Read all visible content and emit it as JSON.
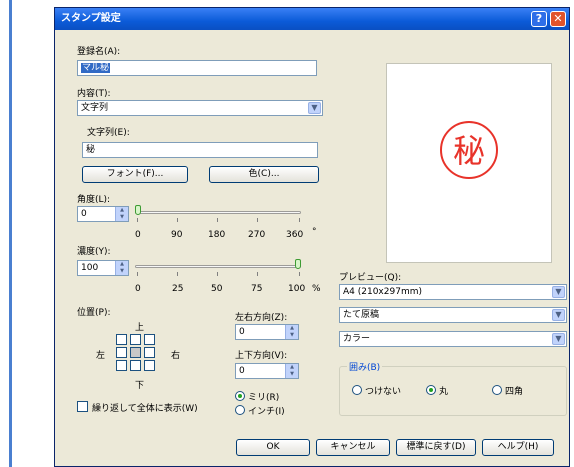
{
  "window": {
    "title": "スタンプ設定",
    "help_glyph": "?",
    "close_glyph": "✕"
  },
  "name": {
    "label": "登録名(A):",
    "value": "マル秘"
  },
  "content": {
    "label": "内容(T):",
    "value": "文字列"
  },
  "text": {
    "label": "文字列(E):",
    "value": "秘"
  },
  "buttons": {
    "font": "フォント(F)...",
    "color": "色(C)...",
    "ok": "OK",
    "cancel": "キャンセル",
    "reset": "標準に戻す(D)",
    "help": "ヘルプ(H)"
  },
  "angle": {
    "label": "角度(L):",
    "value": "0",
    "ticks": [
      "0",
      "90",
      "180",
      "270",
      "360"
    ],
    "unit": "°",
    "level": 0.0
  },
  "density": {
    "label": "濃度(Y):",
    "value": "100",
    "ticks": [
      "0",
      "25",
      "50",
      "75",
      "100"
    ],
    "unit": "%",
    "level": 1.0
  },
  "position": {
    "label": "位置(P):",
    "top": "上",
    "left": "左",
    "right": "右",
    "bottom": "下",
    "selected": "center"
  },
  "horizontal": {
    "label": "左右方向(Z):",
    "value": "0"
  },
  "vertical": {
    "label": "上下方向(V):",
    "value": "0"
  },
  "units": {
    "mm": "ミリ(R)",
    "inch": "インチ(I)",
    "selected": "mm"
  },
  "repeat": {
    "label": "繰り返して全体に表示(W)",
    "checked": false
  },
  "preview": {
    "label": "プレビュー(Q):",
    "stamp_char": "秘",
    "stamp_color": "#e8332a"
  },
  "paper": {
    "value": "A4 (210x297mm)"
  },
  "orientation": {
    "value": "たて原稿"
  },
  "colormode": {
    "value": "カラー"
  },
  "frame": {
    "label": "囲み(B)",
    "options": [
      "つけない",
      "丸",
      "四角"
    ],
    "selected": "丸"
  },
  "colors": {
    "title_bar": "#0b5bd8",
    "dialog_bg": "#ece9d8",
    "link_blue": "#0046d5"
  }
}
